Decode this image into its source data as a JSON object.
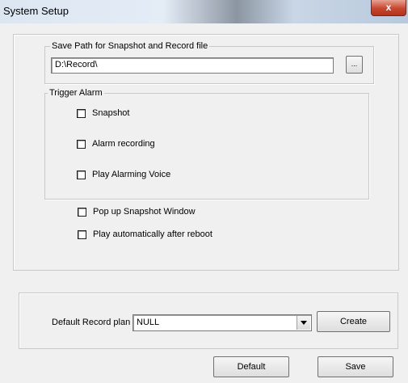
{
  "window": {
    "title": "System Setup",
    "close_glyph": "x"
  },
  "save_path": {
    "legend": "Save Path for Snapshot and Record file",
    "value": "D:\\Record\\",
    "browse_label": "..."
  },
  "trigger_alarm": {
    "legend": "Trigger Alarm",
    "options": [
      {
        "label": "Snapshot",
        "checked": false
      },
      {
        "label": "Alarm recording",
        "checked": false
      },
      {
        "label": "Play Alarming Voice",
        "checked": false
      }
    ]
  },
  "options": [
    {
      "label": "Pop up Snapshot Window",
      "checked": false
    },
    {
      "label": "Play automatically after reboot",
      "checked": false
    }
  ],
  "record_plan": {
    "label": "Default Record plan",
    "selected": "NULL",
    "create_label": "Create"
  },
  "footer": {
    "default_label": "Default",
    "save_label": "Save"
  },
  "icons": {
    "close": "close-icon",
    "dropdown": "chevron-down-icon"
  }
}
